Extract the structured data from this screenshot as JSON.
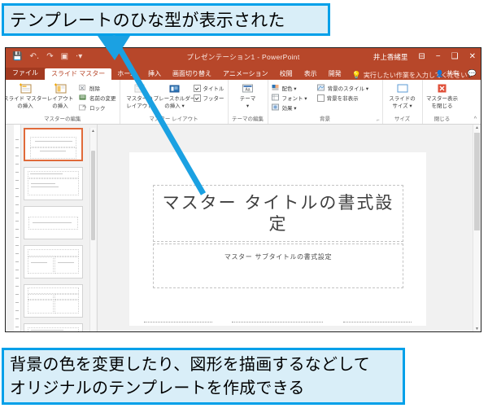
{
  "callouts": {
    "top": "テンプレートのひな型が表示された",
    "bottom_line1": "背景の色を変更したり、図形を描画するなどして",
    "bottom_line2": "オリジナルのテンプレートを作成できる",
    "border_color": "#00a0e9",
    "fill_color": "#d9eef8",
    "arrow_color": "#1ba1e2"
  },
  "window": {
    "title": "プレゼンテーション1 - PowerPoint",
    "user_name": "井上香緒里",
    "accent_color": "#b7472a",
    "quick_access": [
      {
        "name": "save-icon",
        "glyph": "💾"
      },
      {
        "name": "undo-icon",
        "glyph": "↺"
      },
      {
        "name": "redo-icon",
        "glyph": "↻"
      },
      {
        "name": "slideshow-icon",
        "glyph": "▣"
      },
      {
        "name": "customize-qat-icon",
        "glyph": "▾"
      }
    ],
    "controls": [
      {
        "name": "ribbon-display-options-icon",
        "glyph": "⊡"
      },
      {
        "name": "minimize-button",
        "glyph": "−"
      },
      {
        "name": "restore-button",
        "glyph": "❐"
      },
      {
        "name": "close-button",
        "glyph": "✕"
      }
    ]
  },
  "tabs": [
    {
      "label": "ファイル",
      "active": false,
      "file": true
    },
    {
      "label": "スライド マスター",
      "active": true,
      "file": false
    },
    {
      "label": "ホーム",
      "active": false,
      "file": false
    },
    {
      "label": "挿入",
      "active": false,
      "file": false
    },
    {
      "label": "画面切り替え",
      "active": false,
      "file": false
    },
    {
      "label": "アニメーション",
      "active": false,
      "file": false
    },
    {
      "label": "校閲",
      "active": false,
      "file": false
    },
    {
      "label": "表示",
      "active": false,
      "file": false
    },
    {
      "label": "開発",
      "active": false,
      "file": false
    }
  ],
  "tell_me": "実行したい作業を入力してください",
  "share_label": "共有",
  "ribbon": {
    "groups": [
      {
        "label": "マスターの編集",
        "big_buttons": [
          {
            "name": "insert-slide-master-button",
            "line1": "スライド マスター",
            "line2": "の挿入"
          },
          {
            "name": "insert-layout-button",
            "line1": "レイアウト",
            "line2": "の挿入"
          }
        ],
        "small_buttons": [
          {
            "name": "delete-button",
            "label": "削除"
          },
          {
            "name": "rename-button",
            "label": "名前の変更"
          },
          {
            "name": "preserve-button",
            "label": "ロック"
          }
        ]
      },
      {
        "label": "マスター レイアウト",
        "big_buttons": [
          {
            "name": "master-layout-button",
            "line1": "マスターの",
            "line2": "レイアウト"
          },
          {
            "name": "insert-placeholder-button",
            "line1": "プレースホルダー",
            "line2": "の挿入 ▾"
          }
        ],
        "checkboxes": [
          {
            "name": "title-checkbox",
            "label": "タイトル",
            "checked": true
          },
          {
            "name": "footers-checkbox",
            "label": "フッター",
            "checked": true
          }
        ]
      },
      {
        "label": "テーマの編集",
        "big_buttons": [
          {
            "name": "themes-button",
            "line1": "テーマ",
            "line2": "▾"
          }
        ]
      },
      {
        "label": "背景",
        "small_buttons": [
          {
            "name": "colors-button",
            "label": "配色 ▾"
          },
          {
            "name": "fonts-button",
            "label": "フォント ▾"
          },
          {
            "name": "effects-button",
            "label": "効果 ▾"
          },
          {
            "name": "background-styles-button",
            "label": "背景のスタイル ▾"
          },
          {
            "name": "hide-background-graphics-checkbox",
            "label": "背景を非表示"
          }
        ],
        "dialog_launcher": "⌐"
      },
      {
        "label": "サイズ",
        "big_buttons": [
          {
            "name": "slide-size-button",
            "line1": "スライドの",
            "line2": "サイズ ▾"
          }
        ]
      },
      {
        "label": "閉じる",
        "big_buttons": [
          {
            "name": "close-master-view-button",
            "line1": "マスター表示",
            "line2": "を閉じる"
          }
        ]
      }
    ],
    "collapse_glyph": "^"
  },
  "slide": {
    "title_placeholder": "マスター タイトルの書式設定",
    "subtitle_placeholder": "マスター サブタイトルの書式設定"
  },
  "thumbnails": [
    {
      "name": "layout-thumbnail-1",
      "selected": true
    },
    {
      "name": "layout-thumbnail-2",
      "selected": false
    },
    {
      "name": "layout-thumbnail-3",
      "selected": false
    },
    {
      "name": "layout-thumbnail-4",
      "selected": false
    },
    {
      "name": "layout-thumbnail-5",
      "selected": false
    },
    {
      "name": "layout-thumbnail-6",
      "selected": false
    }
  ]
}
